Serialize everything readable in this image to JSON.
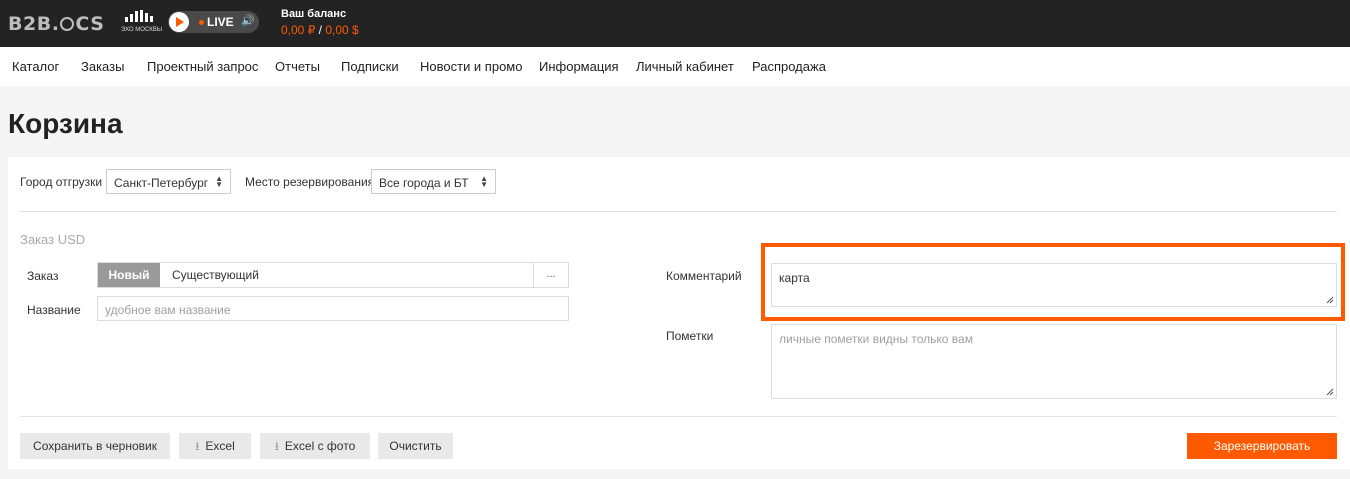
{
  "header": {
    "logo": "B2B OCS",
    "logo_left": "B2B",
    "logo_right": "CS",
    "radio_caption": "ЭХО МОСКВЫ",
    "live_label": "LIVE",
    "balance_title": "Ваш баланс",
    "balance_rub": "0,00 ₽",
    "balance_sep": "/",
    "balance_usd": "0,00 $",
    "accent_color": "#ff5a00"
  },
  "nav": {
    "items": [
      "Каталог",
      "Заказы",
      "Проектный запрос",
      "Отчеты",
      "Подписки",
      "Новости и промо",
      "Информация",
      "Личный кабинет",
      "Распродажа"
    ]
  },
  "page": {
    "title": "Корзина"
  },
  "filters": {
    "city_label": "Город отгрузки",
    "city_value": "Санкт-Петербург",
    "reserve_label": "Место резервирования",
    "reserve_value": "Все города и БТ"
  },
  "order": {
    "section_title": "Заказ USD",
    "order_label": "Заказ",
    "new_label": "Новый",
    "existing_label": "Существующий",
    "more_label": "...",
    "name_label": "Название",
    "name_placeholder": "удобное вам название",
    "comment_label": "Комментарий",
    "comment_value": "карта",
    "notes_label": "Пометки",
    "notes_placeholder": "личные пометки видны только вам"
  },
  "actions": {
    "save_draft": "Сохранить в черновик",
    "excel": "Excel",
    "excel_photo": "Excel с фото",
    "clear": "Очистить",
    "reserve": "Зарезервировать"
  }
}
